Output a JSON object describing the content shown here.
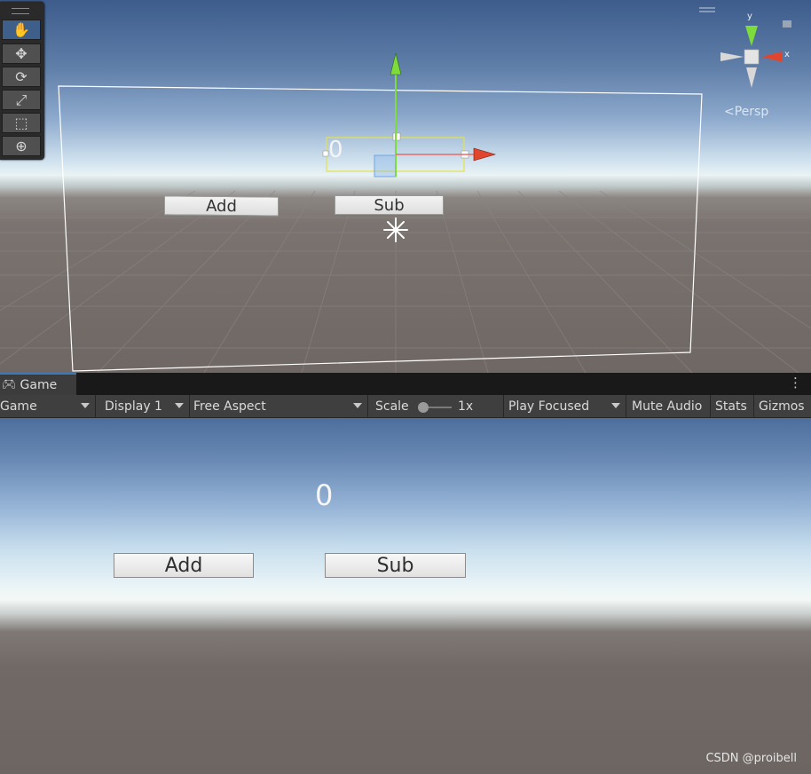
{
  "scene": {
    "tools": [
      {
        "name": "hand-tool",
        "icon": "hand-icon"
      },
      {
        "name": "move-tool",
        "icon": "move-arrows-icon"
      },
      {
        "name": "rotate-tool",
        "icon": "rotate-icon"
      },
      {
        "name": "scale-tool",
        "icon": "scale-icon"
      },
      {
        "name": "rect-tool",
        "icon": "rect-transform-icon"
      },
      {
        "name": "transform-tool",
        "icon": "transform-icon"
      }
    ],
    "counter_text": "0",
    "add_label": "Add",
    "sub_label": "Sub",
    "persp_label": "Persp",
    "gizmo_axis_y": "y",
    "gizmo_axis_x": "x"
  },
  "game_tab": {
    "label": "Game",
    "icon": "gamepad-icon"
  },
  "toolbar": {
    "view_select": "Game",
    "display_select": "Display 1",
    "aspect_select": "Free Aspect",
    "scale_label": "Scale",
    "scale_value": "1x",
    "play_mode": "Play Focused",
    "mute_audio": "Mute Audio",
    "stats": "Stats",
    "gizmos": "Gizmos"
  },
  "game": {
    "counter_text": "0",
    "add_label": "Add",
    "sub_label": "Sub"
  },
  "watermark": "CSDN @proibell",
  "colors": {
    "accent_tab": "#3a79bb",
    "gizmo_y": "#7ddc3c",
    "gizmo_x": "#e0462e",
    "selection": "#e3e34a"
  }
}
